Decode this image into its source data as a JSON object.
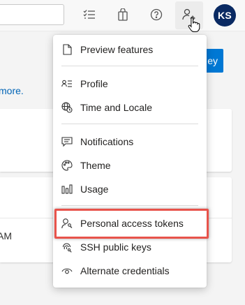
{
  "header": {
    "avatar_initials": "KS"
  },
  "background": {
    "more_link": "more.",
    "primary_button_label": "ey",
    "card_time_text": "AM"
  },
  "menu": {
    "items": [
      {
        "label": "Preview features",
        "icon": "document-icon"
      },
      {
        "label": "Profile",
        "icon": "contact-card-icon"
      },
      {
        "label": "Time and Locale",
        "icon": "globe-clock-icon"
      },
      {
        "label": "Notifications",
        "icon": "comment-icon"
      },
      {
        "label": "Theme",
        "icon": "palette-icon"
      },
      {
        "label": "Usage",
        "icon": "bar-chart-icon"
      },
      {
        "label": "Personal access tokens",
        "icon": "person-key-icon"
      },
      {
        "label": "SSH public keys",
        "icon": "fingerprint-key-icon"
      },
      {
        "label": "Alternate credentials",
        "icon": "eye-icon"
      }
    ]
  },
  "colors": {
    "accent": "#0078d4",
    "avatar_bg": "#0a2a63",
    "highlight_border": "#e8534b",
    "link": "#0064b6"
  }
}
